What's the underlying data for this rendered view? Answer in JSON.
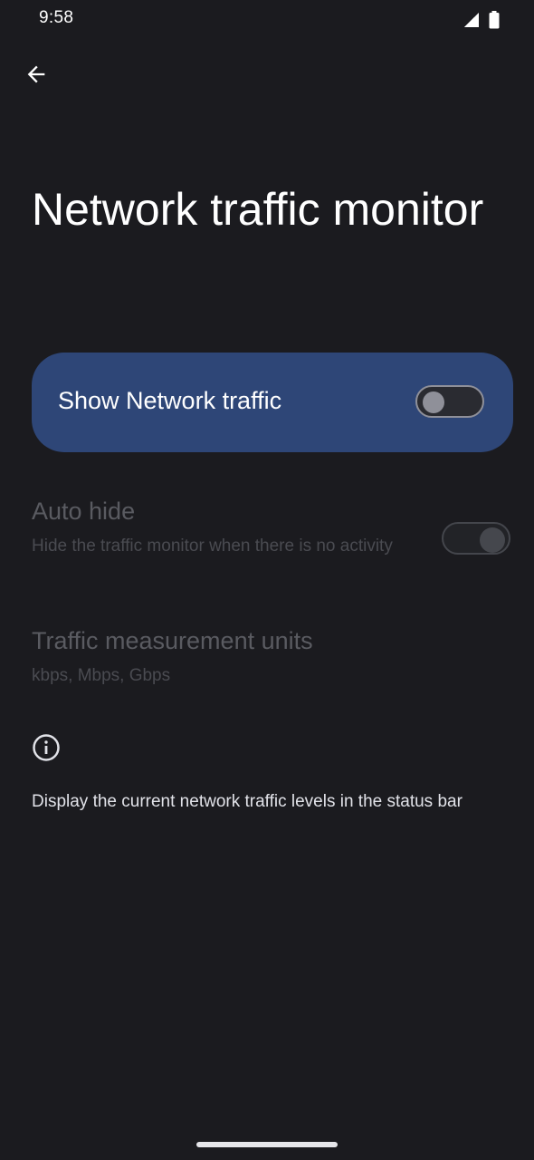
{
  "status_bar": {
    "time": "9:58",
    "icons": [
      "signal-icon",
      "battery-icon"
    ]
  },
  "nav": {
    "back_icon": "arrow-back-icon"
  },
  "page": {
    "title": "Network traffic monitor"
  },
  "main_switch": {
    "label": "Show Network traffic",
    "checked": false,
    "background": "#2e4677"
  },
  "preferences": {
    "auto_hide": {
      "title": "Auto hide",
      "summary": "Hide the traffic monitor when there is no activity",
      "checked": true,
      "enabled": false
    },
    "units": {
      "title": "Traffic measurement units",
      "summary": "kbps, Mbps, Gbps",
      "enabled": false
    }
  },
  "footer": {
    "icon": "info-icon",
    "text": "Display the current network traffic levels in the status bar"
  },
  "colors": {
    "background": "#1b1b1f",
    "accent": "#2e4677",
    "disabled_text": "#5a5b61"
  }
}
